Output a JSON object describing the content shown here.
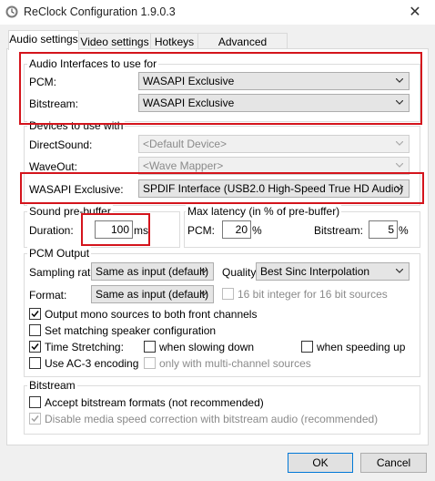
{
  "window": {
    "title": "ReClock Configuration 1.9.0.3",
    "close_glyph": "✕"
  },
  "tabs": [
    "Audio settings",
    "Video settings",
    "Hotkeys",
    "Advanced settings"
  ],
  "interfaces": {
    "legend": "Audio Interfaces to use for",
    "pcm_label": "PCM:",
    "pcm_value": "WASAPI Exclusive",
    "bitstream_label": "Bitstream:",
    "bitstream_value": "WASAPI Exclusive"
  },
  "devices": {
    "legend": "Devices to use with",
    "directsound_label": "DirectSound:",
    "directsound_value": "<Default Device>",
    "waveout_label": "WaveOut:",
    "waveout_value": "<Wave Mapper>",
    "wasapi_label": "WASAPI Exclusive:",
    "wasapi_value": "SPDIF Interface (USB2.0 High-Speed True HD Audio)"
  },
  "prebuffer": {
    "legend": "Sound pre-buffer",
    "duration_label": "Duration:",
    "duration_value": "100",
    "unit": "ms"
  },
  "latency": {
    "legend": "Max latency (in % of pre-buffer)",
    "pcm_label": "PCM:",
    "pcm_value": "20",
    "pcm_unit": "%",
    "bitstream_label": "Bitstream:",
    "bitstream_value": "5",
    "bitstream_unit": "%"
  },
  "pcm_output": {
    "legend": "PCM Output",
    "sampling_label": "Sampling rate:",
    "sampling_value": "Same as input (default)",
    "quality_label": "Quality:",
    "quality_value": "Best Sinc Interpolation",
    "format_label": "Format:",
    "format_value": "Same as input (default)",
    "sixteen_bit_label": "16 bit integer for 16 bit sources",
    "mono_label": "Output mono sources to both front channels",
    "mono_checked": true,
    "speaker_label": "Set matching speaker configuration",
    "speaker_checked": false,
    "stretch_label": "Time Stretching:",
    "stretch_checked": true,
    "slowing_label": "when slowing down",
    "slowing_checked": false,
    "speeding_label": "when speeding up",
    "speeding_checked": false,
    "ac3_label": "Use AC-3 encoding",
    "ac3_checked": false,
    "multichannel_label": "only with multi-channel sources"
  },
  "bitstream_group": {
    "legend": "Bitstream",
    "accept_label": "Accept bitstream formats (not recommended)",
    "accept_checked": false,
    "disable_label": "Disable media speed correction with bitstream audio (recommended)",
    "disable_checked": true
  },
  "buttons": {
    "ok": "OK",
    "cancel": "Cancel"
  },
  "colors": {
    "highlight": "#d4141c",
    "focus": "#0078d7"
  }
}
